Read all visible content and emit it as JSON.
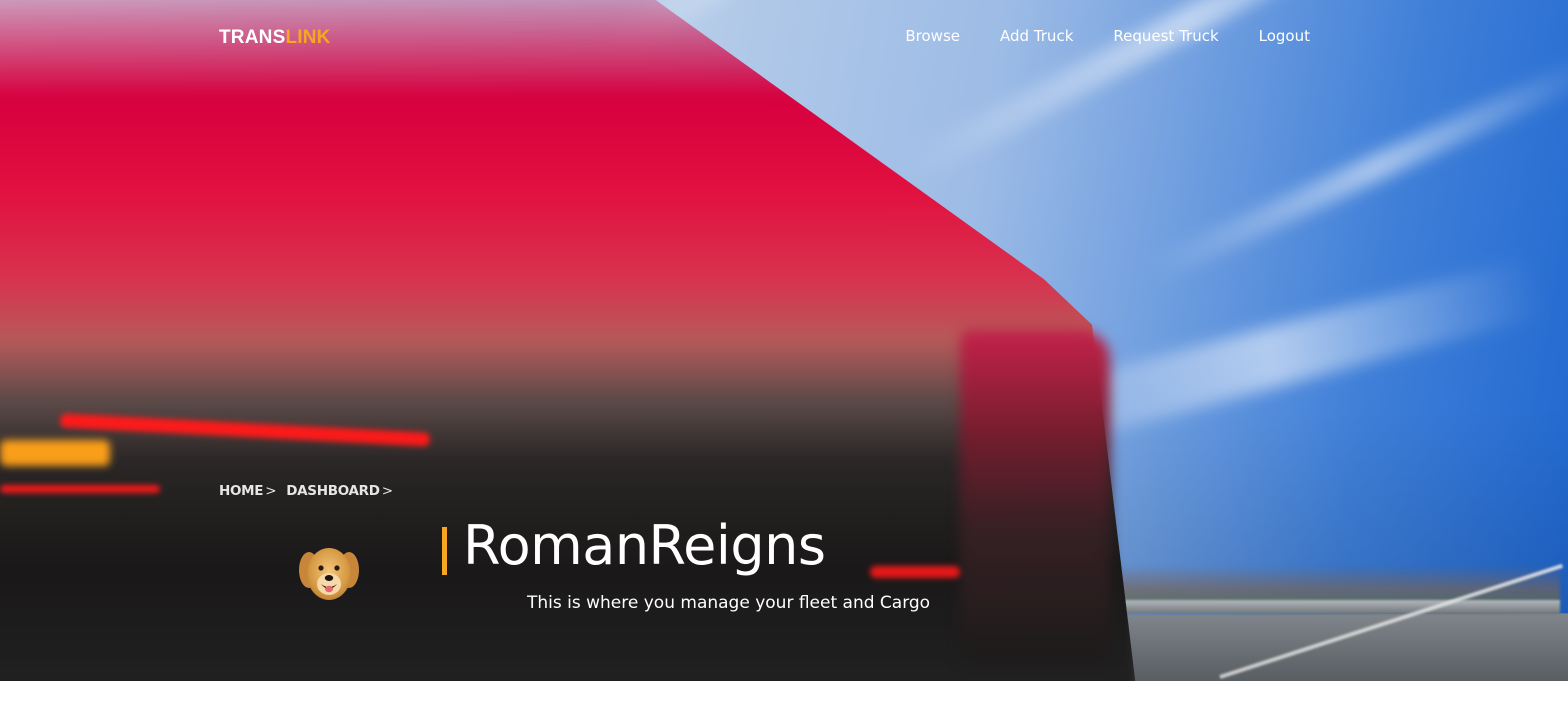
{
  "header": {
    "logo_part1": "TRANS",
    "logo_part2": "LINK",
    "nav": [
      "Browse",
      "Add Truck",
      "Request Truck",
      "Logout"
    ]
  },
  "breadcrumb": {
    "items": [
      "HOME",
      "DASHBOARD"
    ],
    "separator": ">"
  },
  "profile": {
    "username": "RomanReigns",
    "tagline": "This is where you manage your fleet and Cargo",
    "avatar_icon": "dog-avatar"
  },
  "colors": {
    "accent": "#f6a623",
    "text": "#ffffff",
    "background": "#ffffff"
  }
}
